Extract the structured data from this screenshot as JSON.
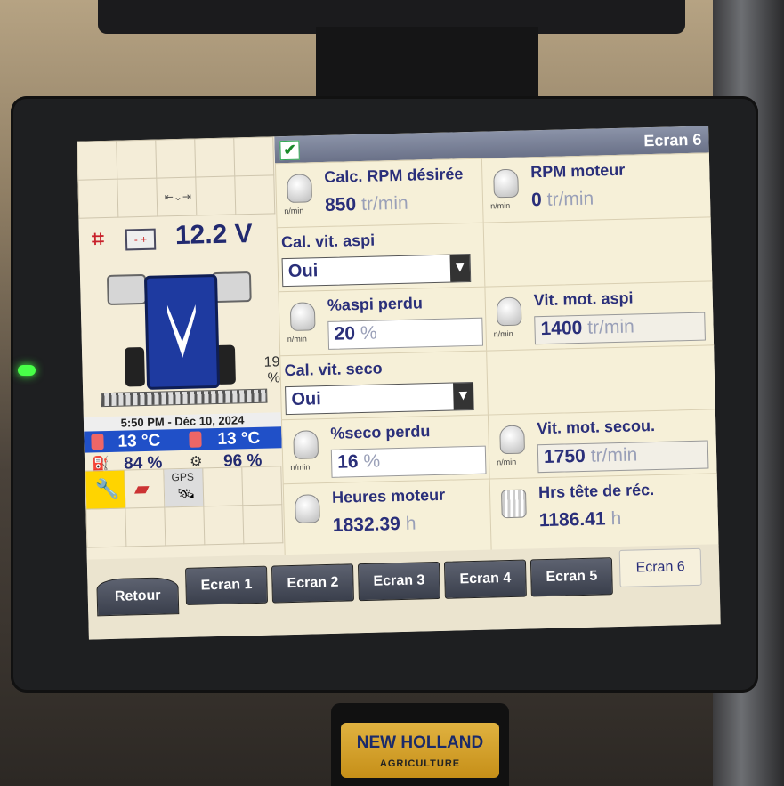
{
  "screen": {
    "title": "Ecran 6",
    "checkbox_checked": true
  },
  "left_panel": {
    "voltage": "12.2 V",
    "side_percent": "19 %",
    "datetime": "5:50 PM - Déc 10, 2024",
    "temp_left": "13 °C",
    "temp_right": "13 °C",
    "fuel_percent": "84 %",
    "def_percent": "96 %",
    "gps_label": "GPS"
  },
  "cards": {
    "calc_rpm": {
      "label": "Calc. RPM désirée",
      "value": "850",
      "unit": "tr/min",
      "icon_unit": "n/min"
    },
    "rpm_moteur": {
      "label": "RPM moteur",
      "value": "0",
      "unit": "tr/min",
      "icon_unit": "n/min"
    },
    "cal_vit_aspi": {
      "label": "Cal. vit. aspi",
      "selected": "Oui"
    },
    "aspi_perdu": {
      "label": "%aspi perdu",
      "value": "20",
      "unit": "%",
      "icon_unit": "n/min"
    },
    "vit_mot_aspi": {
      "label": "Vit. mot. aspi",
      "value": "1400",
      "unit": "tr/min",
      "icon_unit": "n/min"
    },
    "cal_vit_seco": {
      "label": "Cal. vit. seco",
      "selected": "Oui"
    },
    "seco_perdu": {
      "label": "%seco perdu",
      "value": "16",
      "unit": "%",
      "icon_unit": "n/min"
    },
    "vit_mot_secou": {
      "label": "Vit. mot. secou.",
      "value": "1750",
      "unit": "tr/min",
      "icon_unit": "n/min"
    },
    "heures_moteur": {
      "label": "Heures moteur",
      "value": "1832.39",
      "unit": "h"
    },
    "hrs_tete": {
      "label": "Hrs tête de réc.",
      "value": "1186.41",
      "unit": "h"
    }
  },
  "tabs": [
    {
      "label": "Retour"
    },
    {
      "label": "Ecran 1"
    },
    {
      "label": "Ecran 2"
    },
    {
      "label": "Ecran 3"
    },
    {
      "label": "Ecran 4"
    },
    {
      "label": "Ecran 5"
    },
    {
      "label": "Ecran 6",
      "active": true
    }
  ],
  "badge": {
    "brand": "NEW HOLLAND",
    "sub": "AGRICULTURE"
  },
  "colors": {
    "accent_blue": "#2050c8",
    "text_navy": "#2a2f7a",
    "led": "#48ff48"
  }
}
